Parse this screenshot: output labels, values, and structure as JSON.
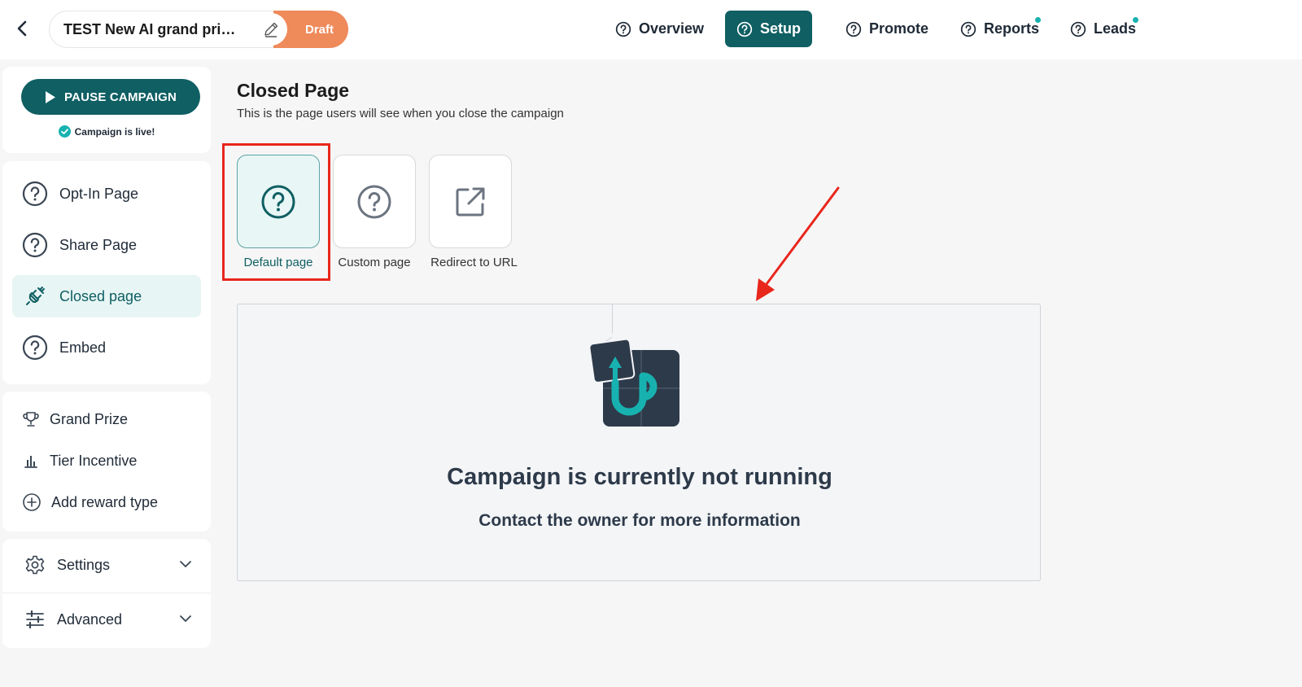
{
  "topbar": {
    "campaign_title": "TEST New AI grand pri…",
    "status_label": "Draft",
    "nav": [
      {
        "label": "Overview",
        "active": false,
        "dot": false
      },
      {
        "label": "Setup",
        "active": true,
        "dot": false
      },
      {
        "label": "Promote",
        "active": false,
        "dot": false
      },
      {
        "label": "Reports",
        "active": false,
        "dot": true
      },
      {
        "label": "Leads",
        "active": false,
        "dot": true
      }
    ]
  },
  "sidebar": {
    "pause_button": "PAUSE CAMPAIGN",
    "live_status": "Campaign is live!",
    "pages": [
      {
        "label": "Opt-In Page",
        "icon": "question-circle-icon",
        "active": false
      },
      {
        "label": "Share Page",
        "icon": "question-circle-icon",
        "active": false
      },
      {
        "label": "Closed page",
        "icon": "unplugged-icon",
        "active": true
      },
      {
        "label": "Embed",
        "icon": "question-circle-icon",
        "active": false
      }
    ],
    "rewards": [
      {
        "label": "Grand Prize",
        "icon": "trophy-icon"
      },
      {
        "label": "Tier Incentive",
        "icon": "bar-chart-icon"
      },
      {
        "label": "Add reward type",
        "icon": "plus-circle-icon"
      }
    ],
    "settings_label": "Settings",
    "advanced_label": "Advanced"
  },
  "main": {
    "title": "Closed Page",
    "subtitle": "This is the page users will see when you close the campaign",
    "options": [
      {
        "label": "Default page",
        "icon": "question-circle-icon",
        "selected": true
      },
      {
        "label": "Custom page",
        "icon": "question-circle-icon",
        "selected": false
      },
      {
        "label": "Redirect to URL",
        "icon": "external-link-icon",
        "selected": false
      }
    ],
    "preview": {
      "headline": "Campaign is currently not running",
      "subline": "Contact the owner for more information"
    }
  },
  "colors": {
    "brand_teal": "#0f5f63",
    "draft_orange": "#ef8a5b",
    "annotation_red": "#e8261c",
    "notification_dot": "#17b2b0"
  }
}
